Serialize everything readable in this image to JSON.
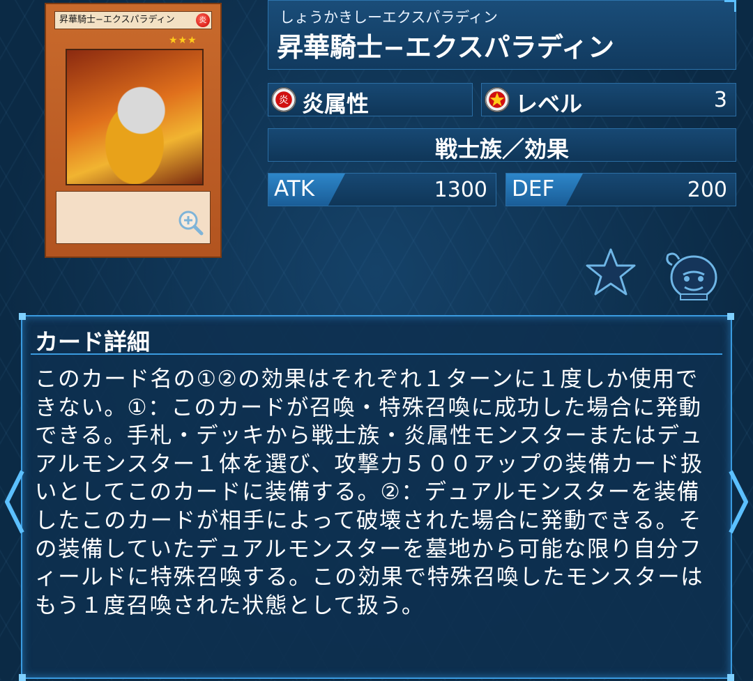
{
  "card_image": {
    "name_on_card": "昇華騎士−エクスパラディン",
    "attribute_glyph": "炎",
    "stars": "★★★"
  },
  "header": {
    "ruby": "しょうかきしーエクスパラディン",
    "name": "昇華騎士−エクスパラディン"
  },
  "attribute": {
    "icon_glyph": "炎",
    "label": "炎属性"
  },
  "level": {
    "label": "レベル",
    "value": "3"
  },
  "type_line": "戦士族／効果",
  "atk": {
    "label": "ATK",
    "value": "1300"
  },
  "def": {
    "label": "DEF",
    "value": "200"
  },
  "detail": {
    "heading": "カード詳細",
    "text": "このカード名の①②の効果はそれぞれ１ターンに１度しか使用できない。①：このカードが召喚・特殊召喚に成功した場合に発動できる。手札・デッキから戦士族・炎属性モンスターまたはデュアルモンスター１体を選び、攻撃力５００アップの装備カード扱いとしてこのカードに装備する。②：デュアルモンスターを装備したこのカードが相手によって破壊された場合に発動できる。その装備していたデュアルモンスターを墓地から可能な限り自分フィールドに特殊召喚する。この効果で特殊召喚したモンスターはもう１度召喚された状態として扱う。"
  },
  "icons": {
    "zoom": "zoom-in-icon",
    "favorite": "star-icon",
    "deck": "deck-pot-icon",
    "prev": "chevron-left-icon",
    "next": "chevron-right-icon"
  },
  "colors": {
    "panel_border": "#3a9be0",
    "tab_blue": "#2d86c9",
    "fire_red": "#d01010",
    "star_navy": "#15355a"
  }
}
